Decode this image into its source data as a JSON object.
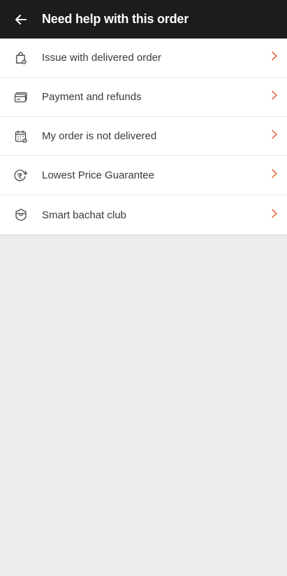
{
  "header": {
    "title": "Need help with this order",
    "back_icon": "arrow-left-icon"
  },
  "colors": {
    "header_bg": "#1c1c1c",
    "accent": "#e8572a",
    "page_bg": "#ececec"
  },
  "help_topics": [
    {
      "label": "Issue with delivered order",
      "icon": "shopping-bag-icon"
    },
    {
      "label": "Payment and refunds",
      "icon": "card-icon"
    },
    {
      "label": "My order is not delivered",
      "icon": "calendar-icon"
    },
    {
      "label": "Lowest Price Guarantee",
      "icon": "rupee-refresh-icon"
    },
    {
      "label": "Smart bachat club",
      "icon": "shield-bag-icon"
    }
  ]
}
